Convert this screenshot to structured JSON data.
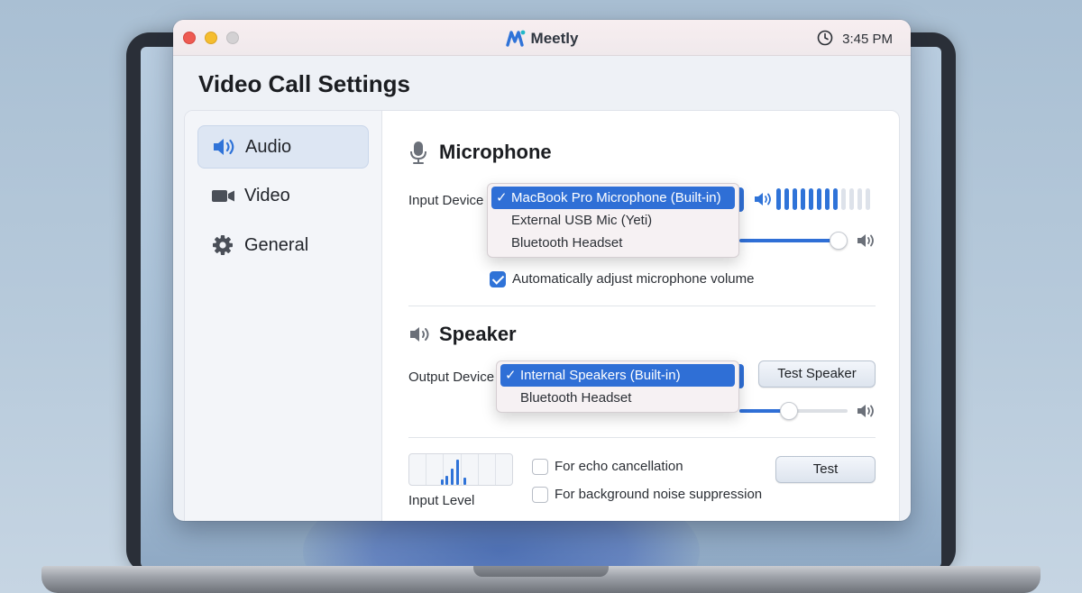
{
  "window": {
    "app_name": "Meetly",
    "time": "3:45 PM"
  },
  "page": {
    "title": "Video Call Settings"
  },
  "sidebar": {
    "items": [
      {
        "label": "Audio",
        "icon": "speaker-icon",
        "active": true
      },
      {
        "label": "Video",
        "icon": "video-camera-icon",
        "active": false
      },
      {
        "label": "General",
        "icon": "gear-icon",
        "active": false
      }
    ]
  },
  "microphone": {
    "title": "Microphone",
    "input_device_label": "Input Device",
    "options": [
      "MacBook Pro Microphone (Built-in)",
      "External USB Mic (Yeti)",
      "Bluetooth Headset"
    ],
    "selected_option": "MacBook Pro Microphone (Built-in)",
    "input_meter_level": 0.67,
    "volume_level": 1.0,
    "auto_adjust_label": "Automatically adjust microphone volume",
    "auto_adjust_checked": true
  },
  "speaker": {
    "title": "Speaker",
    "output_device_label": "Output Device",
    "options": [
      "Internal Speakers (Built-in)",
      "Bluetooth Headset"
    ],
    "selected_option": "Internal Speakers (Built-in)",
    "test_button_label": "Test Speaker",
    "volume_level": 0.46
  },
  "input_level": {
    "label": "Input Level",
    "echo_cancellation_label": "For echo cancellation",
    "echo_cancellation_checked": false,
    "noise_suppression_label": "For background noise suppression",
    "noise_suppression_checked": false,
    "test_button_label": "Test"
  },
  "colors": {
    "accent": "#2f6fd6",
    "window_bg": "#eef1f6",
    "sidebar_active": "#dde6f3"
  }
}
